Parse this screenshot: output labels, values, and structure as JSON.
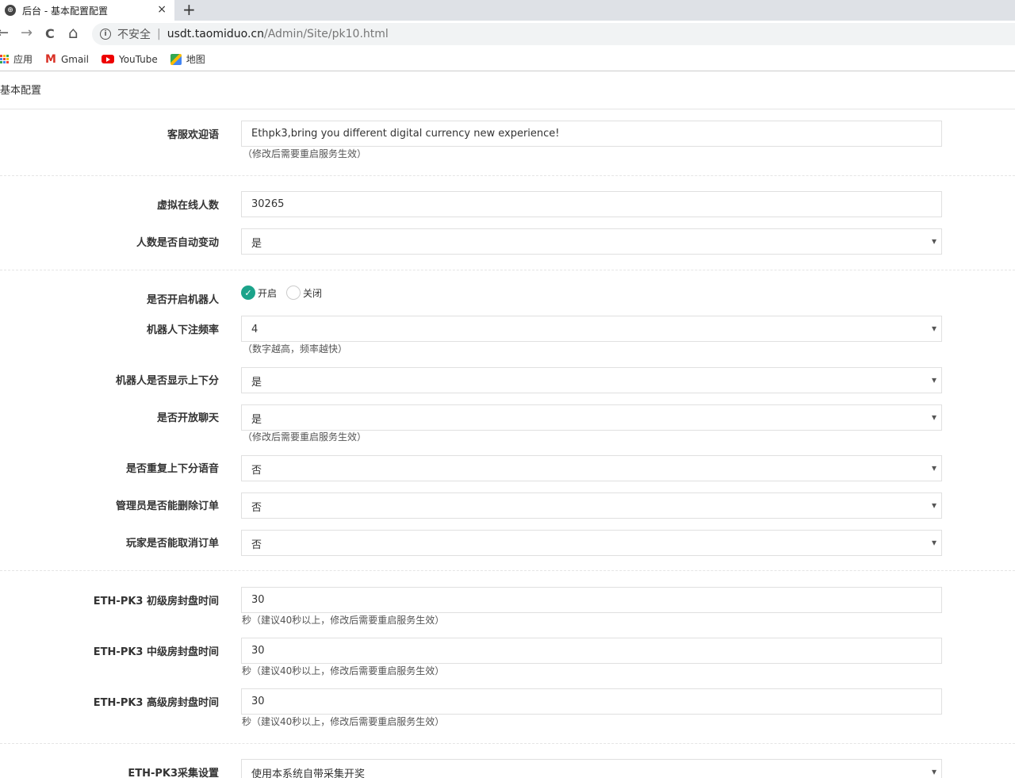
{
  "browser": {
    "tab_title": "后台 - 基本配置配置",
    "close_glyph": "×",
    "new_tab_glyph": "+",
    "back_glyph": "←",
    "forward_glyph": "→",
    "reload_glyph": "C",
    "home_glyph": "⌂",
    "info_glyph": "i",
    "insecure_label": "不安全",
    "url_separator": "|",
    "url_host": "usdt.taomiduo.cn",
    "url_path": "/Admin/Site/pk10.html",
    "bookmarks": [
      {
        "label": "应用",
        "icon": "apps-icon"
      },
      {
        "label": "Gmail",
        "icon": "gmail-icon"
      },
      {
        "label": "YouTube",
        "icon": "youtube-icon"
      },
      {
        "label": "地图",
        "icon": "maps-icon"
      }
    ]
  },
  "page": {
    "title": "基本配置",
    "welcome_label": "客服欢迎语",
    "welcome_value": "Ethpk3,bring you different digital currency new experience!",
    "restart_note": "（修改后需要重启服务生效）",
    "virtual_online_label": "虚拟在线人数",
    "virtual_online_value": "30265",
    "auto_change_label": "人数是否自动变动",
    "auto_change_value": "是",
    "robot_enable_label": "是否开启机器人",
    "robot_on_label": "开启",
    "robot_off_label": "关闭",
    "robot_on_selected": true,
    "robot_freq_label": "机器人下注频率",
    "robot_freq_value": "4",
    "robot_freq_note": "（数字越高，频率越快）",
    "robot_show_score_label": "机器人是否显示上下分",
    "robot_show_score_value": "是",
    "chat_open_label": "是否开放聊天",
    "chat_open_value": "是",
    "chat_restart_note": "（修改后需要重启服务生效）",
    "repeat_voice_label": "是否重复上下分语音",
    "repeat_voice_value": "否",
    "admin_delete_label": "管理员是否能删除订单",
    "admin_delete_value": "否",
    "player_cancel_label": "玩家是否能取消订单",
    "player_cancel_value": "否",
    "junior_close_label": "ETH-PK3 初级房封盘时间",
    "junior_close_value": "30",
    "middle_close_label": "ETH-PK3 中级房封盘时间",
    "middle_close_value": "30",
    "senior_close_label": "ETH-PK3 高级房封盘时间",
    "senior_close_value": "30",
    "seconds_note": "秒（建议40秒以上，修改后需要重启服务生效）",
    "collect_label": "ETH-PK3采集设置",
    "collect_value": "使用本系统自带采集开奖"
  },
  "colors": {
    "accent": "#1ba38a"
  }
}
